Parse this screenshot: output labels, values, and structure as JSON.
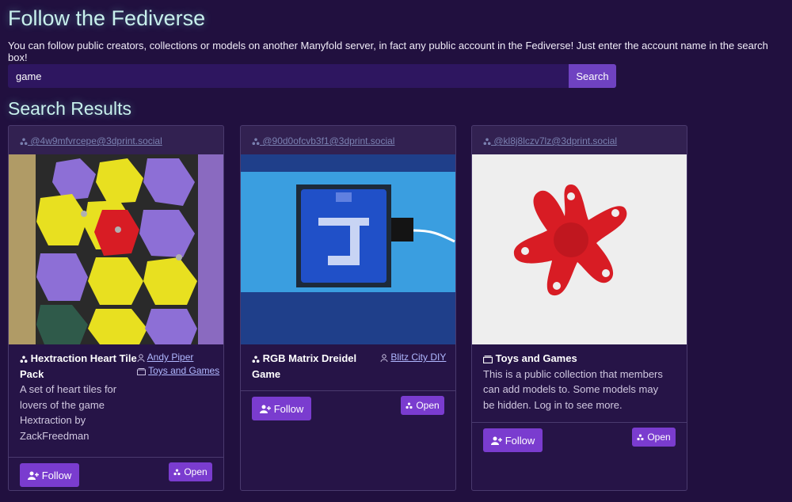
{
  "page": {
    "title": "Follow the Fediverse",
    "intro": "You can follow public creators, collections or models on another Manyfold server, in fact any public account in the Fediverse! Just enter the account name in the search box!"
  },
  "search": {
    "value": "game",
    "button_label": "Search"
  },
  "results": {
    "title": "Search Results",
    "cards": [
      {
        "account": "@4w9mfvrcepe@3dprint.social",
        "kind": "model",
        "name": "Hextraction Heart Tile Pack",
        "description": "A set of heart tiles for lovers of the game Hextraction by ZackFreedman",
        "creator": "Andy Piper",
        "collection": "Toys and Games",
        "follow_label": "Follow",
        "open_label": "Open"
      },
      {
        "account": "@90d0ofcvb3f1@3dprint.social",
        "kind": "model",
        "name": "RGB Matrix Dreidel Game",
        "creator": "Blitz City DIY",
        "follow_label": "Follow",
        "open_label": "Open"
      },
      {
        "account": "@kl8j8lczv7lz@3dprint.social",
        "kind": "collection",
        "name": "Toys and Games",
        "description": "This is a public collection that members can add models to. Some models may be hidden. Log in to see more.",
        "follow_label": "Follow",
        "open_label": "Open"
      }
    ]
  },
  "colors": {
    "background": "#21103f",
    "accent": "#7a3ccf",
    "heading": "#c8f0ec"
  }
}
